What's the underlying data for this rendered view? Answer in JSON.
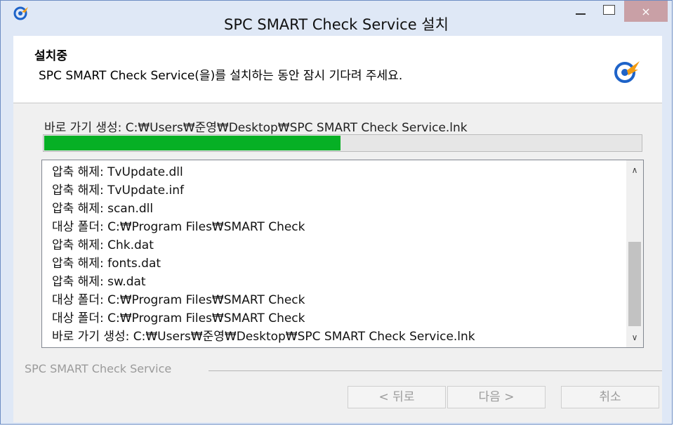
{
  "window": {
    "title": "SPC SMART Check Service 설치",
    "close_glyph": "×"
  },
  "header": {
    "heading": "설치중",
    "subheading": "SPC SMART Check Service(을)를 설치하는 동안 잠시 기다려 주세요."
  },
  "status": {
    "current": "바로 가기 생성: C:₩Users₩준영₩Desktop₩SPC SMART Check Service.lnk",
    "progress_fraction": 0.495
  },
  "log": [
    "압축 해제: TvUpdate.dll",
    "압축 해제: TvUpdate.inf",
    "압축 해제: scan.dll",
    "대상 폴더: C:₩Program Files₩SMART Check",
    "압축 해제: Chk.dat",
    "압축 해제: fonts.dat",
    "압축 해제: sw.dat",
    "대상 폴더: C:₩Program Files₩SMART Check",
    "대상 폴더: C:₩Program Files₩SMART Check",
    "바로 가기 생성: C:₩Users₩준영₩Desktop₩SPC SMART Check Service.lnk"
  ],
  "footer": {
    "brand": "SPC SMART Check Service",
    "back_label": "< 뒤로",
    "next_label": "다음 >",
    "cancel_label": "취소"
  },
  "colors": {
    "progress": "#06b025",
    "titlebar": "#dfe8f6",
    "logo_blue": "#1e63c8",
    "logo_orange": "#f39c12"
  },
  "icons": {
    "app": "spc-logo-icon",
    "header": "spc-logo-icon",
    "scroll_up": "chevron-up-icon",
    "scroll_down": "chevron-down-icon"
  }
}
